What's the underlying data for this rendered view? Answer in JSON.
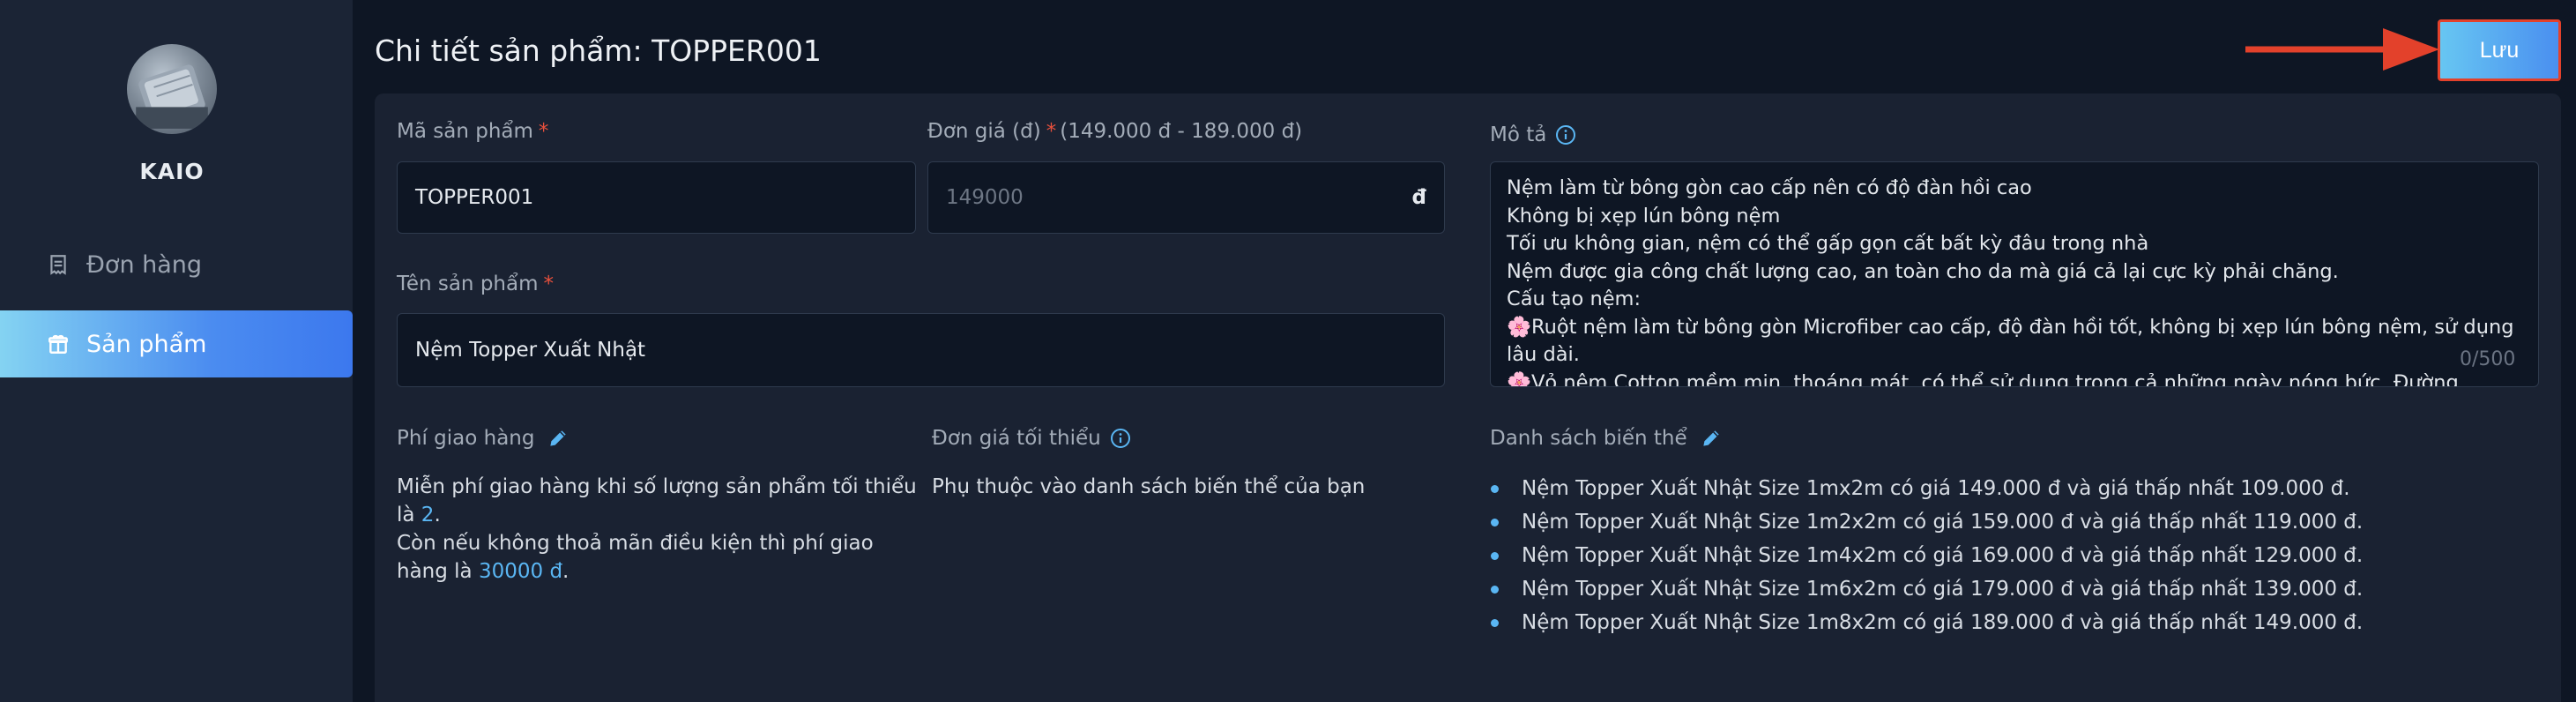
{
  "sidebar": {
    "brand": "KAIO",
    "items": [
      {
        "label": "Đơn hàng",
        "icon": "receipt-icon",
        "active": false
      },
      {
        "label": "Sản phẩm",
        "icon": "gift-icon",
        "active": true
      }
    ]
  },
  "header": {
    "title": "Chi tiết sản phẩm: TOPPER001",
    "save_label": "Lưu"
  },
  "form": {
    "code": {
      "label": "Mã sản phẩm",
      "required": "*",
      "value": "TOPPER001"
    },
    "price": {
      "label": "Đơn giá (đ)",
      "required": "*",
      "range": "(149.000 đ - 189.000 đ)",
      "value": "149000",
      "suffix": "đ"
    },
    "name": {
      "label": "Tên sản phẩm",
      "required": "*",
      "value": "Nệm Topper Xuất Nhật"
    },
    "description": {
      "label": "Mô tả",
      "value": "Nệm làm từ bông gòn cao cấp nên có độ đàn hồi cao\nKhông bị xẹp lún bông nệm\nTối ưu không gian, nệm có thể gấp gọn cất bất kỳ đâu trong nhà\nNệm được gia công chất lượng cao, an toàn cho da mà giá cả lại cực kỳ phải chăng.\nCấu tạo nệm:\n🌸Ruột nệm làm từ bông gòn Microfiber cao cấp, độ đàn hồi tốt, không bị xẹp lún bông nệm, sử dụng lâu dài.\n🌸Vỏ nệm Cotton mềm mịn, thoáng mát, có thể sử dụng trong cả những ngày nóng bức. Đường",
      "counter": "0/500"
    }
  },
  "shipping": {
    "label": "Phí giao hàng",
    "text1": "Miễn phí giao hàng khi số lượng sản phẩm tối thiểu là ",
    "min_qty": "2",
    "text2": "Còn nếu không thoả mãn điều kiện thì phí giao hàng là ",
    "fee": "30000 đ"
  },
  "min_price": {
    "label": "Đơn giá tối thiểu",
    "text": "Phụ thuộc vào danh sách biến thể của bạn"
  },
  "variants": {
    "label": "Danh sách biến thể",
    "items": [
      "Nệm Topper Xuất Nhật Size 1mx2m có giá 149.000 đ và giá thấp nhất 109.000 đ.",
      "Nệm Topper Xuất Nhật Size 1m2x2m có giá 159.000 đ và giá thấp nhất 119.000 đ.",
      "Nệm Topper Xuất Nhật Size 1m4x2m có giá 169.000 đ và giá thấp nhất 129.000 đ.",
      "Nệm Topper Xuất Nhật Size 1m6x2m có giá 179.000 đ và giá thấp nhất 139.000 đ.",
      "Nệm Topper Xuất Nhật Size 1m8x2m có giá 189.000 đ và giá thấp nhất 149.000 đ."
    ]
  },
  "colors": {
    "background": "#0e1624",
    "sidebar": "#1b2435",
    "card": "#1a2232",
    "accent": "#4b8cf0",
    "link": "#5ab6f3",
    "required": "#e8503c",
    "annotation": "#e3412b"
  }
}
